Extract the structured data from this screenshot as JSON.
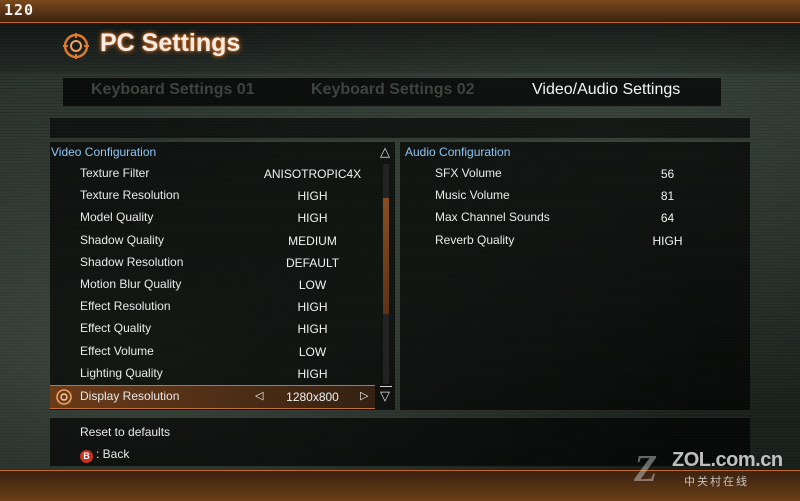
{
  "hud": {
    "fps": "120"
  },
  "header": {
    "title": "PC Settings",
    "title_icon": "crosshair-ring-icon"
  },
  "tabs": [
    {
      "label": "Keyboard Settings 01",
      "active": false
    },
    {
      "label": "Keyboard Settings 02",
      "active": false
    },
    {
      "label": "Video/Audio Settings",
      "active": true
    }
  ],
  "video": {
    "heading": "Video Configuration",
    "rows": [
      {
        "label": "Texture Filter",
        "value": "ANISOTROPIC4X"
      },
      {
        "label": "Texture Resolution",
        "value": "HIGH"
      },
      {
        "label": "Model Quality",
        "value": "HIGH"
      },
      {
        "label": "Shadow Quality",
        "value": "MEDIUM"
      },
      {
        "label": "Shadow Resolution",
        "value": "DEFAULT"
      },
      {
        "label": "Motion Blur Quality",
        "value": "LOW"
      },
      {
        "label": "Effect Resolution",
        "value": "HIGH"
      },
      {
        "label": "Effect Quality",
        "value": "HIGH"
      },
      {
        "label": "Effect Volume",
        "value": "LOW"
      },
      {
        "label": "Lighting Quality",
        "value": "HIGH"
      },
      {
        "label": "Display Resolution",
        "value": "1280x800",
        "selected": true
      }
    ],
    "scroll_up": "△",
    "scroll_down": "▽",
    "arrow_left": "◁",
    "arrow_right": "▷"
  },
  "audio": {
    "heading": "Audio Configuration",
    "rows": [
      {
        "label": "SFX Volume",
        "value": "56"
      },
      {
        "label": "Music Volume",
        "value": "81"
      },
      {
        "label": "Max Channel Sounds",
        "value": "64"
      },
      {
        "label": "Reverb Quality",
        "value": "HIGH"
      }
    ]
  },
  "footer": {
    "reset_label": "Reset to defaults",
    "back_button_glyph": "B",
    "back_label": ": Back"
  },
  "watermark": {
    "main": "ZOL.com.cn",
    "sub": "中关村在线",
    "logo_letter": "Z"
  },
  "colors": {
    "accent": "#c76a1d",
    "heading": "#8fc4f2",
    "selected_row": "#b45a1e"
  }
}
